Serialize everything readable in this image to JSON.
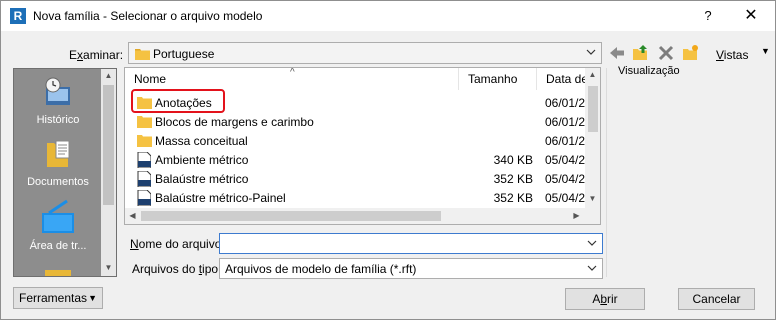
{
  "window": {
    "title": "Nova família - Selecionar o arquivo modelo",
    "app_icon_letter": "R",
    "help_label": "?",
    "close_label": "✕"
  },
  "toolbar": {
    "look_in_label_pre": "E",
    "look_in_label_u": "x",
    "look_in_label_post": "aminar:",
    "look_in_value": "Portuguese",
    "views_label_u": "V",
    "views_label_post": "istas",
    "icons": [
      "back-icon",
      "up-folder-icon",
      "delete-icon",
      "new-folder-icon"
    ]
  },
  "places": [
    {
      "label": "Histórico",
      "icon": "history-icon"
    },
    {
      "label": "Documentos",
      "icon": "documents-icon"
    },
    {
      "label": "Área de tr...",
      "icon": "desktop-icon"
    }
  ],
  "filelist": {
    "columns": {
      "name": "Nome",
      "size": "Tamanho",
      "date": "Data de"
    },
    "rows": [
      {
        "name": "Anotações",
        "size": "",
        "date": "06/01/2",
        "type": "folder"
      },
      {
        "name": "Blocos de margens e carimbo",
        "size": "",
        "date": "06/01/2",
        "type": "folder"
      },
      {
        "name": "Massa conceitual",
        "size": "",
        "date": "06/01/2",
        "type": "folder"
      },
      {
        "name": "Ambiente métrico",
        "size": "340 KB",
        "date": "05/04/2",
        "type": "rft"
      },
      {
        "name": "Balaústre métrico",
        "size": "352 KB",
        "date": "05/04/2",
        "type": "rft"
      },
      {
        "name": "Balaústre métrico-Painel",
        "size": "352 KB",
        "date": "05/04/2",
        "type": "rft"
      }
    ]
  },
  "preview": {
    "label": "Visualização"
  },
  "filename": {
    "label_pre": "",
    "label_u": "N",
    "label_post": "ome do arquivo:",
    "value": ""
  },
  "filetype": {
    "label_pre": "Arquivos do ",
    "label_u": "t",
    "label_post": "ipo:",
    "value": "Arquivos de modelo de família  (*.rft)"
  },
  "buttons": {
    "tools": "Ferramentas",
    "open_pre": "A",
    "open_u": "b",
    "open_post": "rir",
    "cancel": "Cancelar"
  },
  "colors": {
    "highlight": "#e3121b",
    "folder": "#f5c242",
    "accent": "#1d6fb8"
  }
}
